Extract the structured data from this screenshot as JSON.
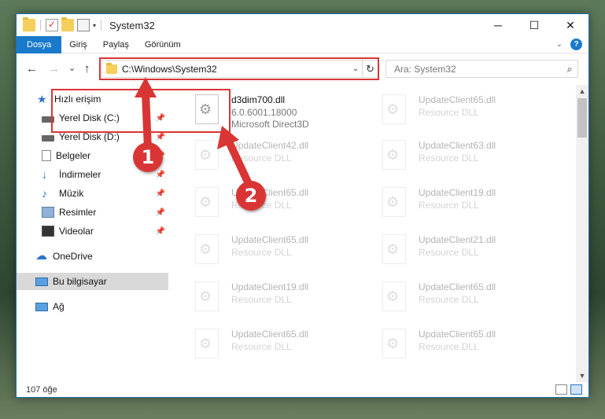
{
  "titlebar": {
    "title": "System32",
    "minimize": "─",
    "maximize": "☐",
    "close": "✕"
  },
  "ribbon": {
    "tabs": [
      "Dosya",
      "Giriş",
      "Paylaş",
      "Görünüm"
    ],
    "active_tab": "Dosya",
    "help": "?"
  },
  "nav": {
    "back": "←",
    "forward": "→",
    "recent": "⌄",
    "up": "↑",
    "address": "C:\\Windows\\System32",
    "search_placeholder": "Ara: System32"
  },
  "sidebar": {
    "items": [
      {
        "label": "Hızlı erişim",
        "icon": "star-icon",
        "pinned": false
      },
      {
        "label": "Yerel Disk (C:)",
        "icon": "disk-icon",
        "pinned": true
      },
      {
        "label": "Yerel Disk (D:)",
        "icon": "disk-icon",
        "pinned": true
      },
      {
        "label": "Belgeler",
        "icon": "documents-icon",
        "pinned": true
      },
      {
        "label": "İndirmeler",
        "icon": "download-icon",
        "pinned": true
      },
      {
        "label": "Müzik",
        "icon": "music-icon",
        "pinned": true
      },
      {
        "label": "Resimler",
        "icon": "pictures-icon",
        "pinned": true
      },
      {
        "label": "Videolar",
        "icon": "videos-icon",
        "pinned": true
      },
      {
        "label": "OneDrive",
        "icon": "onedrive-icon",
        "pinned": false
      },
      {
        "label": "Bu bilgisayar",
        "icon": "this-pc-icon",
        "pinned": false,
        "selected": true
      },
      {
        "label": "Ağ",
        "icon": "network-icon",
        "pinned": false
      }
    ]
  },
  "files": {
    "highlighted": {
      "name": "d3dim700.dll",
      "version": "6.0.6001.18000",
      "description": "Microsoft Direct3D"
    },
    "left_column": [
      {
        "name": "UpdateClient42.dll",
        "type": "Resource DLL"
      },
      {
        "name": "UpdateClient65.dll",
        "type": "Resource DLL"
      },
      {
        "name": "UpdateClient65.dll",
        "type": "Resource DLL"
      },
      {
        "name": "UpdateClient19.dll",
        "type": "Resource DLL"
      },
      {
        "name": "UpdateClient65.dll",
        "type": "Resource DLL"
      }
    ],
    "right_column": [
      {
        "name": "UpdateClient65.dll",
        "type": "Resource DLL"
      },
      {
        "name": "UpdateClient63.dll",
        "type": "Resource DLL"
      },
      {
        "name": "UpdateClient19.dll",
        "type": "Resource DLL"
      },
      {
        "name": "UpdateClient21.dll",
        "type": "Resource DLL"
      },
      {
        "name": "UpdateClient65.dll",
        "type": "Resource DLL"
      },
      {
        "name": "UpdateClient65.dll",
        "type": "Resource DLL"
      }
    ]
  },
  "status": {
    "count": "107 öğe"
  },
  "callouts": {
    "step1": "1",
    "step2": "2"
  },
  "colors": {
    "accent": "#1979ca",
    "highlight": "#d93535"
  }
}
